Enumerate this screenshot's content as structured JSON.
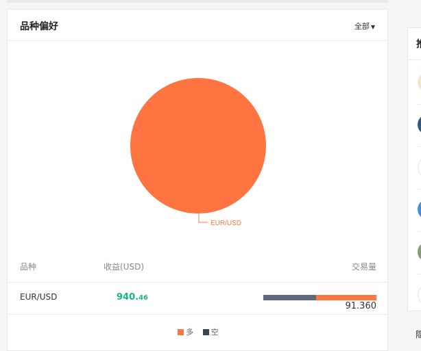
{
  "card": {
    "title": "品种偏好",
    "filter_label": "全部"
  },
  "pie_chart": {
    "slices": [
      {
        "label": "EUR/USD",
        "value": 100,
        "color": "#ff7440"
      }
    ]
  },
  "table": {
    "headers": {
      "symbol": "品种",
      "profit": "收益(USD)",
      "volume": "交易量"
    },
    "rows": [
      {
        "symbol": "EUR/USD",
        "profit_int": "940.",
        "profit_dec": "46",
        "volume": "91.360",
        "long_fraction": 0.535,
        "short_fraction": 0.465
      }
    ]
  },
  "legend": {
    "items": [
      {
        "label": "多",
        "color": "#ff7440"
      },
      {
        "label": "空",
        "color": "#37475a"
      }
    ]
  },
  "right_panel": {
    "header_char": "推",
    "bottom_char": "隐"
  },
  "colors": {
    "long": "#ff7440",
    "short": "#5a6b7e",
    "profit_positive": "#1bb28a"
  }
}
